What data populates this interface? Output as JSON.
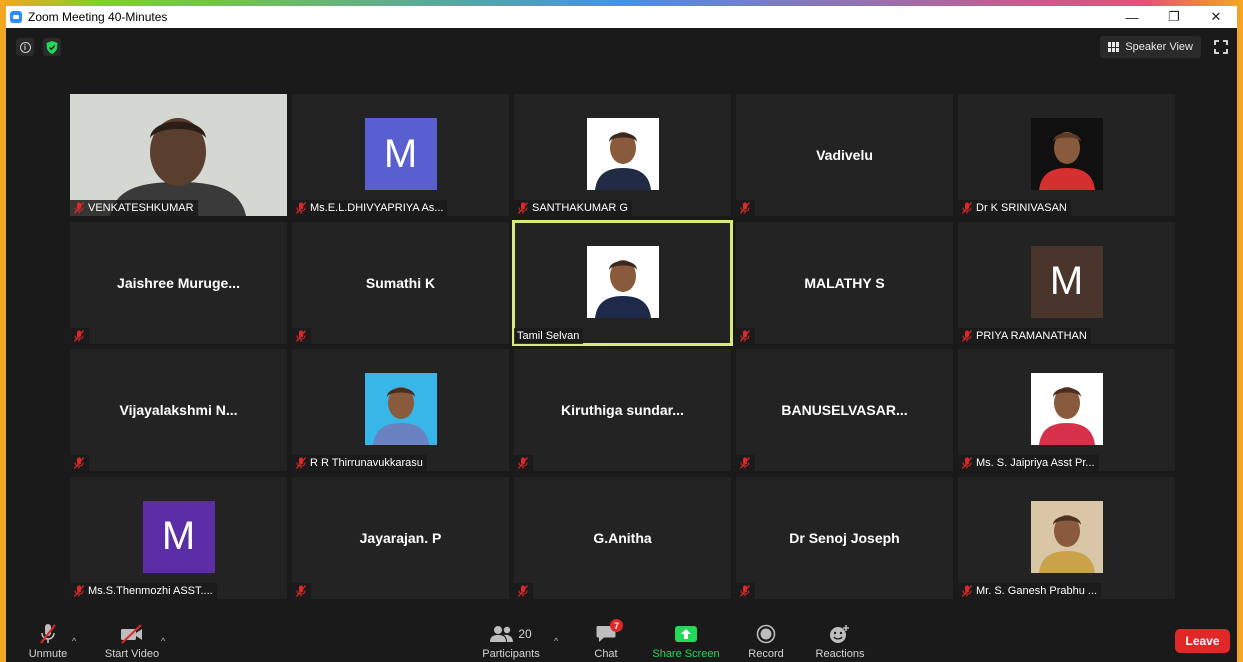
{
  "window": {
    "title": "Zoom Meeting 40-Minutes",
    "controls": {
      "minimize": "—",
      "restore": "❐",
      "close": "✕"
    }
  },
  "topbar": {
    "speaker_view_label": "Speaker View"
  },
  "participants": [
    {
      "name": "VENKATESHKUMAR",
      "kind": "video",
      "muted": true
    },
    {
      "name": "Ms.E.L.DHIVYAPRIYA As...",
      "kind": "avatar",
      "letter": "M",
      "avatar_color": "#5a5fcf",
      "muted": true
    },
    {
      "name": "SANTHAKUMAR G",
      "kind": "photo",
      "muted": true
    },
    {
      "display": "Vadivelu",
      "kind": "name",
      "muted": true
    },
    {
      "name": "Dr K SRINIVASAN",
      "kind": "photo",
      "muted": true
    },
    {
      "display": "Jaishree  Muruge...",
      "kind": "name",
      "muted": true
    },
    {
      "display": "Sumathi K",
      "kind": "name",
      "muted": true
    },
    {
      "name": "Tamil Selvan",
      "kind": "photo",
      "muted": false,
      "active": true
    },
    {
      "display": "MALATHY S",
      "kind": "name",
      "muted": true
    },
    {
      "name": "PRIYA RAMANATHAN",
      "kind": "avatar",
      "letter": "M",
      "avatar_color": "#4a352d",
      "muted": true
    },
    {
      "display": "Vijayalakshmi  N...",
      "kind": "name",
      "muted": true
    },
    {
      "name": "R R Thirrunavukkarasu",
      "kind": "photo",
      "muted": true
    },
    {
      "display": "Kiruthiga  sundar...",
      "kind": "name",
      "muted": true
    },
    {
      "display": "BANUSELVASAR...",
      "kind": "name",
      "muted": true
    },
    {
      "name": "Ms. S. Jaipriya Asst Pr...",
      "kind": "photo",
      "muted": true
    },
    {
      "name": "Ms.S.Thenmozhi ASST....",
      "kind": "avatar",
      "letter": "M",
      "avatar_color": "#5b2ea6",
      "muted": true
    },
    {
      "display": "Jayarajan. P",
      "kind": "name",
      "muted": true
    },
    {
      "display": "G.Anitha",
      "kind": "name",
      "muted": true
    },
    {
      "display": "Dr Senoj Joseph",
      "kind": "name",
      "muted": true
    },
    {
      "name": "Mr. S. Ganesh Prabhu ...",
      "kind": "photo",
      "muted": true
    }
  ],
  "toolbar": {
    "unmute_label": "Unmute",
    "start_video_label": "Start Video",
    "participants_label": "Participants",
    "participants_count": "20",
    "chat_label": "Chat",
    "chat_badge": "7",
    "share_screen_label": "Share Screen",
    "record_label": "Record",
    "reactions_label": "Reactions",
    "leave_label": "Leave",
    "caret": "^"
  }
}
